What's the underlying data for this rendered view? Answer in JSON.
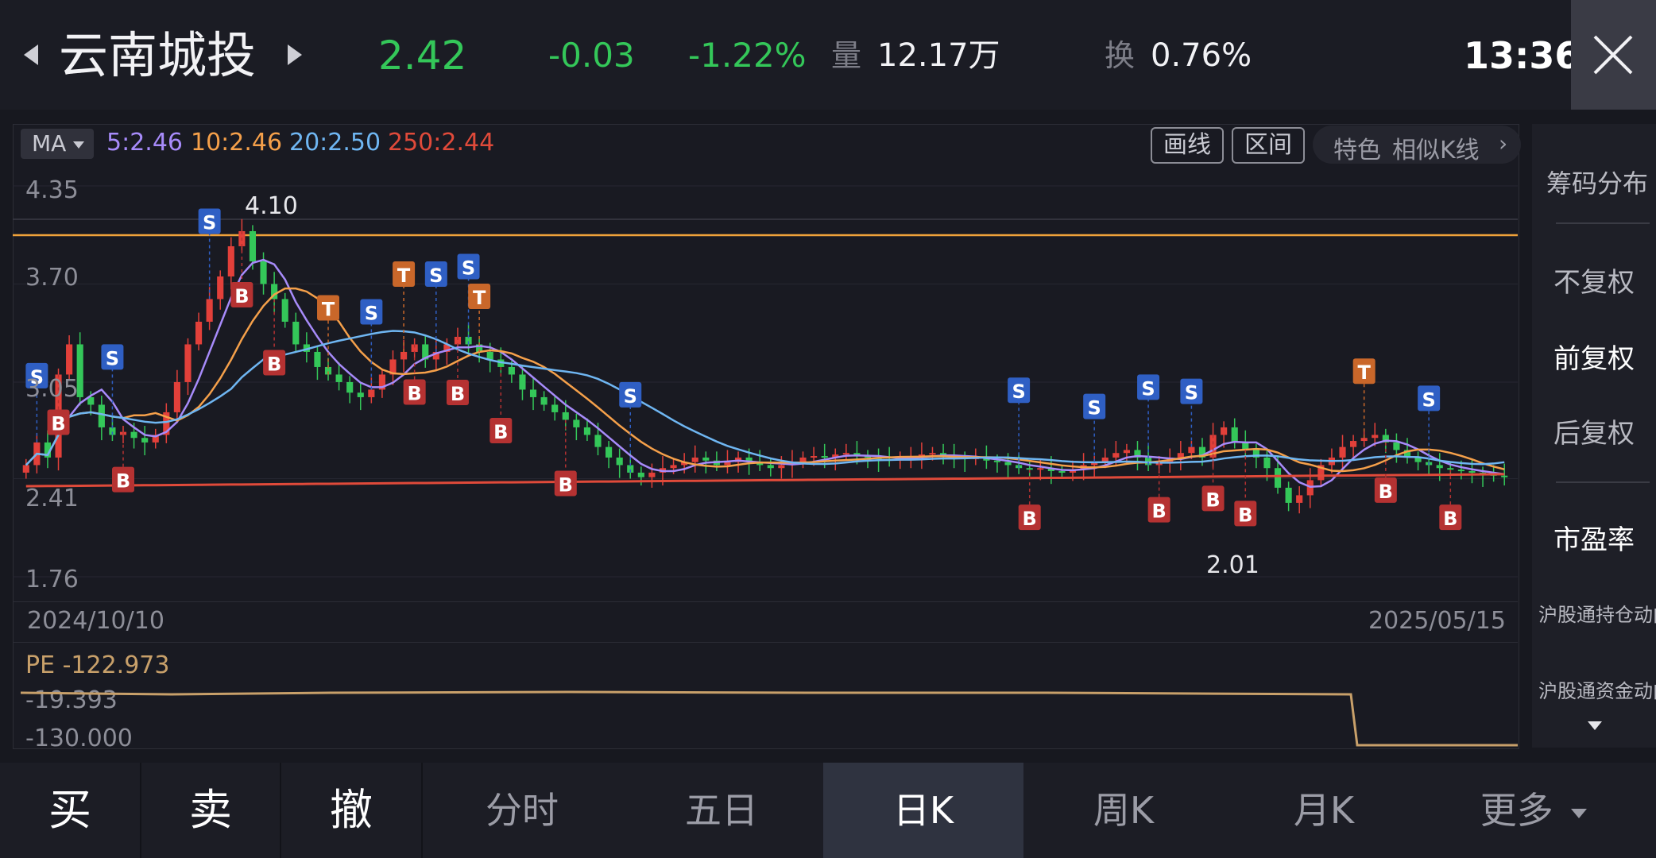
{
  "header": {
    "stock_name": "云南城投",
    "price": "2.42",
    "change": "-0.03",
    "change_pct": "-1.22%",
    "volume_label": "量",
    "volume_value": "12.17万",
    "turnover_label": "换",
    "turnover_value": "0.76%",
    "time": "13:36"
  },
  "ma": {
    "selector": "MA",
    "ma5": "5:2.46",
    "ma10": "10:2.46",
    "ma20": "20:2.50",
    "ma250": "250:2.44",
    "colors": {
      "ma5": "#a78bfa",
      "ma10": "#f5a04a",
      "ma20": "#6fb6f2",
      "ma250": "#e04a3a"
    }
  },
  "toolbar": {
    "draw_line": "画线",
    "interval": "区间",
    "feature": "特色",
    "similar_k": "相似K线"
  },
  "price_axis": {
    "top": "4.35",
    "upper": "3.70",
    "mid": "3.05",
    "lower": "2.41",
    "bottom": "1.76"
  },
  "annotations": {
    "high": "4.10",
    "low": "2.01"
  },
  "date_axis": {
    "start": "2024/10/10",
    "end": "2025/05/15"
  },
  "pe_panel": {
    "title": "PE -122.973",
    "upper": "-19.393",
    "lower": "-130.000",
    "line_color": "#c8a06a"
  },
  "sidebar": {
    "chip_distribution": "筹码分布",
    "no_adjust": "不复权",
    "forward_adjust": "前复权",
    "backward_adjust": "后复权",
    "pe_ratio": "市盈率",
    "hk_connect_holding": "沪股通持仓动向",
    "hk_connect_funds": "沪股通资金动向"
  },
  "bottom_bar": {
    "buy": "买",
    "sell": "卖",
    "cancel": "撤",
    "intraday": "分时",
    "five_day": "五日",
    "daily_k": "日K",
    "weekly_k": "周K",
    "monthly_k": "月K",
    "more": "更多"
  },
  "colors": {
    "up": "#e2403a",
    "down": "#34c759",
    "accent_orange": "#f0a23a"
  },
  "chart_data": {
    "type": "candlestick",
    "x_range": [
      "2024/10/10",
      "2025/05/15"
    ],
    "ylim": [
      1.76,
      4.35
    ],
    "y_ticks": [
      4.35,
      3.7,
      3.05,
      2.41,
      1.76
    ],
    "max_marker": 4.1,
    "min_marker": 2.01,
    "current": 2.42,
    "ma_last": {
      "ma5": 2.46,
      "ma10": 2.46,
      "ma20": 2.5,
      "ma250": 2.44
    },
    "closes": [
      2.5,
      2.65,
      2.55,
      3.1,
      3.3,
      2.95,
      2.9,
      2.75,
      2.7,
      2.72,
      2.68,
      2.65,
      2.7,
      2.85,
      3.05,
      3.3,
      3.45,
      3.6,
      3.75,
      3.95,
      4.05,
      3.85,
      3.7,
      3.6,
      3.45,
      3.3,
      3.25,
      3.15,
      3.1,
      3.05,
      2.98,
      2.95,
      3.0,
      3.1,
      3.2,
      3.25,
      3.3,
      3.2,
      3.25,
      3.3,
      3.35,
      3.3,
      3.25,
      3.2,
      3.15,
      3.1,
      3.0,
      2.95,
      2.9,
      2.85,
      2.8,
      2.75,
      2.7,
      2.62,
      2.55,
      2.5,
      2.45,
      2.42,
      2.45,
      2.48,
      2.5,
      2.52,
      2.55,
      2.53,
      2.5,
      2.52,
      2.55,
      2.52,
      2.5,
      2.48,
      2.5,
      2.52,
      2.55,
      2.56,
      2.55,
      2.57,
      2.58,
      2.56,
      2.55,
      2.54,
      2.53,
      2.55,
      2.56,
      2.57,
      2.58,
      2.56,
      2.55,
      2.54,
      2.55,
      2.53,
      2.52,
      2.5,
      2.48,
      2.47,
      2.48,
      2.46,
      2.45,
      2.47,
      2.5,
      2.52,
      2.55,
      2.58,
      2.6,
      2.55,
      2.5,
      2.52,
      2.55,
      2.58,
      2.62,
      2.55,
      2.7,
      2.75,
      2.65,
      2.6,
      2.55,
      2.48,
      2.35,
      2.25,
      2.3,
      2.4,
      2.5,
      2.55,
      2.62,
      2.66,
      2.68,
      2.7,
      2.65,
      2.6,
      2.55,
      2.52,
      2.5,
      2.48,
      2.47,
      2.46,
      2.45,
      2.44,
      2.43,
      2.42
    ],
    "pe": {
      "values": [
        -19.393,
        -130.0
      ],
      "switch_point": "2025/04"
    }
  }
}
